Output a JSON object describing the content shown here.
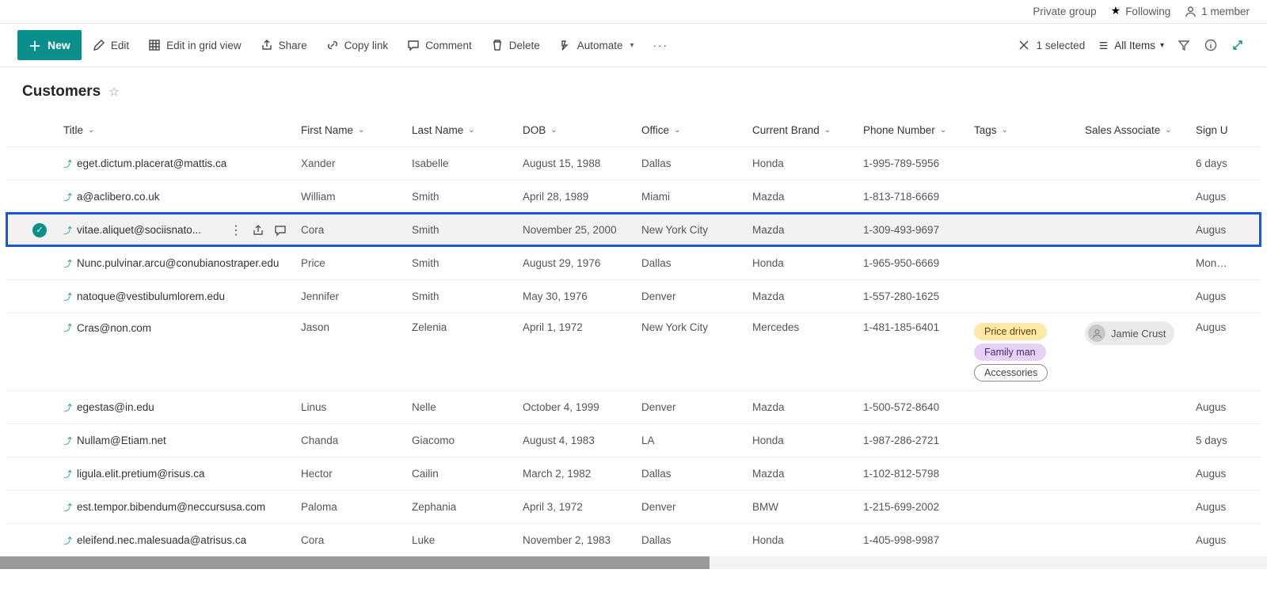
{
  "header": {
    "private_group": "Private group",
    "following": "Following",
    "member_count": "1 member"
  },
  "commands": {
    "new": "New",
    "edit": "Edit",
    "grid": "Edit in grid view",
    "share": "Share",
    "copylink": "Copy link",
    "comment": "Comment",
    "delete": "Delete",
    "automate": "Automate",
    "selected": "1 selected",
    "view_name": "All Items"
  },
  "list": {
    "title": "Customers"
  },
  "columns": {
    "title": "Title",
    "first": "First Name",
    "last": "Last Name",
    "dob": "DOB",
    "office": "Office",
    "brand": "Current Brand",
    "phone": "Phone Number",
    "tags": "Tags",
    "assoc": "Sales Associate",
    "signup": "Sign U"
  },
  "rows": [
    {
      "title": "eget.dictum.placerat@mattis.ca",
      "first": "Xander",
      "last": "Isabelle",
      "dob": "August 15, 1988",
      "office": "Dallas",
      "brand": "Honda",
      "phone": "1-995-789-5956",
      "tags": [],
      "assoc": "",
      "signup": "6 days"
    },
    {
      "title": "a@aclibero.co.uk",
      "first": "William",
      "last": "Smith",
      "dob": "April 28, 1989",
      "office": "Miami",
      "brand": "Mazda",
      "phone": "1-813-718-6669",
      "tags": [],
      "assoc": "",
      "signup": "Augus"
    },
    {
      "title": "vitae.aliquet@sociisnato...",
      "first": "Cora",
      "last": "Smith",
      "dob": "November 25, 2000",
      "office": "New York City",
      "brand": "Mazda",
      "phone": "1-309-493-9697",
      "tags": [],
      "assoc": "",
      "signup": "Augus",
      "selected": true
    },
    {
      "title": "Nunc.pulvinar.arcu@conubianostraper.edu",
      "first": "Price",
      "last": "Smith",
      "dob": "August 29, 1976",
      "office": "Dallas",
      "brand": "Honda",
      "phone": "1-965-950-6669",
      "tags": [],
      "assoc": "",
      "signup": "Monda"
    },
    {
      "title": "natoque@vestibulumlorem.edu",
      "first": "Jennifer",
      "last": "Smith",
      "dob": "May 30, 1976",
      "office": "Denver",
      "brand": "Mazda",
      "phone": "1-557-280-1625",
      "tags": [],
      "assoc": "",
      "signup": "Augus"
    },
    {
      "title": "Cras@non.com",
      "first": "Jason",
      "last": "Zelenia",
      "dob": "April 1, 1972",
      "office": "New York City",
      "brand": "Mercedes",
      "phone": "1-481-185-6401",
      "tags": [
        "Price driven",
        "Family man",
        "Accessories"
      ],
      "assoc": "Jamie Crust",
      "signup": "Augus",
      "tall": true
    },
    {
      "title": "egestas@in.edu",
      "first": "Linus",
      "last": "Nelle",
      "dob": "October 4, 1999",
      "office": "Denver",
      "brand": "Mazda",
      "phone": "1-500-572-8640",
      "tags": [],
      "assoc": "",
      "signup": "Augus"
    },
    {
      "title": "Nullam@Etiam.net",
      "first": "Chanda",
      "last": "Giacomo",
      "dob": "August 4, 1983",
      "office": "LA",
      "brand": "Honda",
      "phone": "1-987-286-2721",
      "tags": [],
      "assoc": "",
      "signup": "5 days"
    },
    {
      "title": "ligula.elit.pretium@risus.ca",
      "first": "Hector",
      "last": "Cailin",
      "dob": "March 2, 1982",
      "office": "Dallas",
      "brand": "Mazda",
      "phone": "1-102-812-5798",
      "tags": [],
      "assoc": "",
      "signup": "Augus"
    },
    {
      "title": "est.tempor.bibendum@neccursusa.com",
      "first": "Paloma",
      "last": "Zephania",
      "dob": "April 3, 1972",
      "office": "Denver",
      "brand": "BMW",
      "phone": "1-215-699-2002",
      "tags": [],
      "assoc": "",
      "signup": "Augus"
    },
    {
      "title": "eleifend.nec.malesuada@atrisus.ca",
      "first": "Cora",
      "last": "Luke",
      "dob": "November 2, 1983",
      "office": "Dallas",
      "brand": "Honda",
      "phone": "1-405-998-9987",
      "tags": [],
      "assoc": "",
      "signup": "Augus"
    }
  ]
}
